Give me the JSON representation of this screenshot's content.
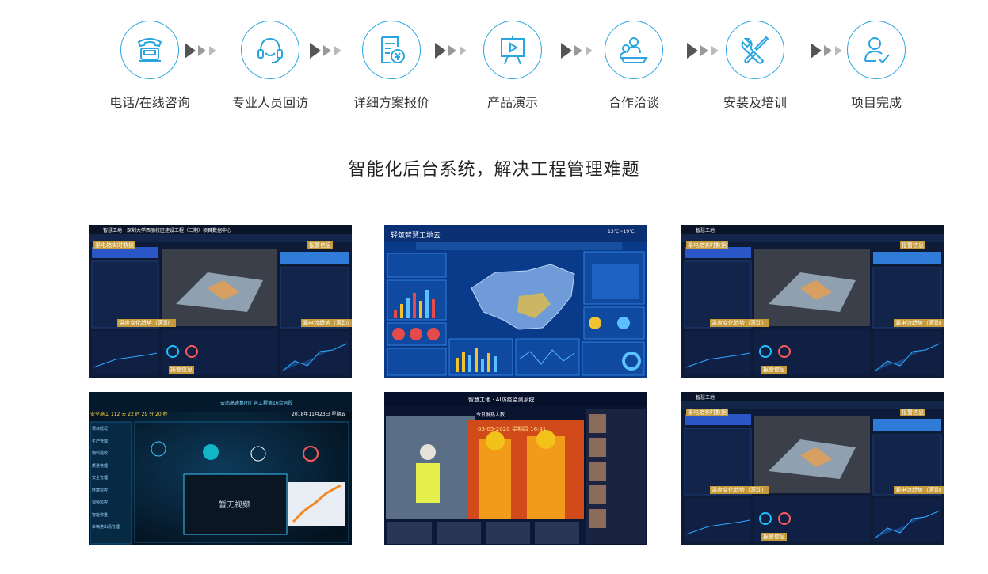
{
  "process": {
    "steps": [
      {
        "label": "电话/在线咨询",
        "icon": "telephone-icon"
      },
      {
        "label": "专业人员回访",
        "icon": "headset-icon"
      },
      {
        "label": "详细方案报价",
        "icon": "quotation-document-icon"
      },
      {
        "label": "产品演示",
        "icon": "presentation-board-icon"
      },
      {
        "label": "合作洽谈",
        "icon": "meeting-people-icon"
      },
      {
        "label": "安装及培训",
        "icon": "tools-icon"
      },
      {
        "label": "项目完成",
        "icon": "user-check-icon"
      }
    ]
  },
  "headline": "智能化后台系统，解决工程管理难题",
  "gallery": {
    "s1": {
      "title": "智慧工地",
      "subtitle": "深圳大学西丽校区建设工程（二期）项目数据中心",
      "p1": "渠电箱实时数据",
      "p2": "报警信息",
      "p3": "温度变化趋势（滚动）",
      "p4": "漏电流趋势（滚动）",
      "p5": "报警信息"
    },
    "s2": {
      "title": "轻筑智慧工地云",
      "time": "13℃~19℃"
    },
    "s3": {
      "title": "智慧工地",
      "p1": "渠电箱实时数据",
      "p2": "报警信息",
      "p3": "温度变化趋势（滚动）",
      "p4": "漏电流趋势（滚动）",
      "p5": "报警信息"
    },
    "s4": {
      "title": "云南高速集团扩容工程第16合同段",
      "safe": "安全施工 112 天 22 时 29 分 20 秒",
      "date": "2018年11月23日 星期五",
      "video": "暂无视频",
      "menu": [
        "项目概况",
        "生产管理",
        "物料验收",
        "质量管理",
        "安全管理",
        "环境监控",
        "视频监控",
        "智能称重",
        "车辆进出场管理"
      ]
    },
    "s5": {
      "title": "智慧工地 · AI防疫监测系统",
      "today": "今日发热人数",
      "stamp": "03-05-2020 星期四 16:41"
    },
    "s6": {
      "title": "智慧工地",
      "p1": "渠电箱实时数据",
      "p2": "报警信息",
      "p3": "温度变化趋势（滚动）",
      "p4": "漏电流趋势（滚动）",
      "p5": "报警信息"
    }
  },
  "colors": {
    "accent": "#29a6e0",
    "arrow_dark": "#555555",
    "arrow_light": "#bbbbbb"
  }
}
